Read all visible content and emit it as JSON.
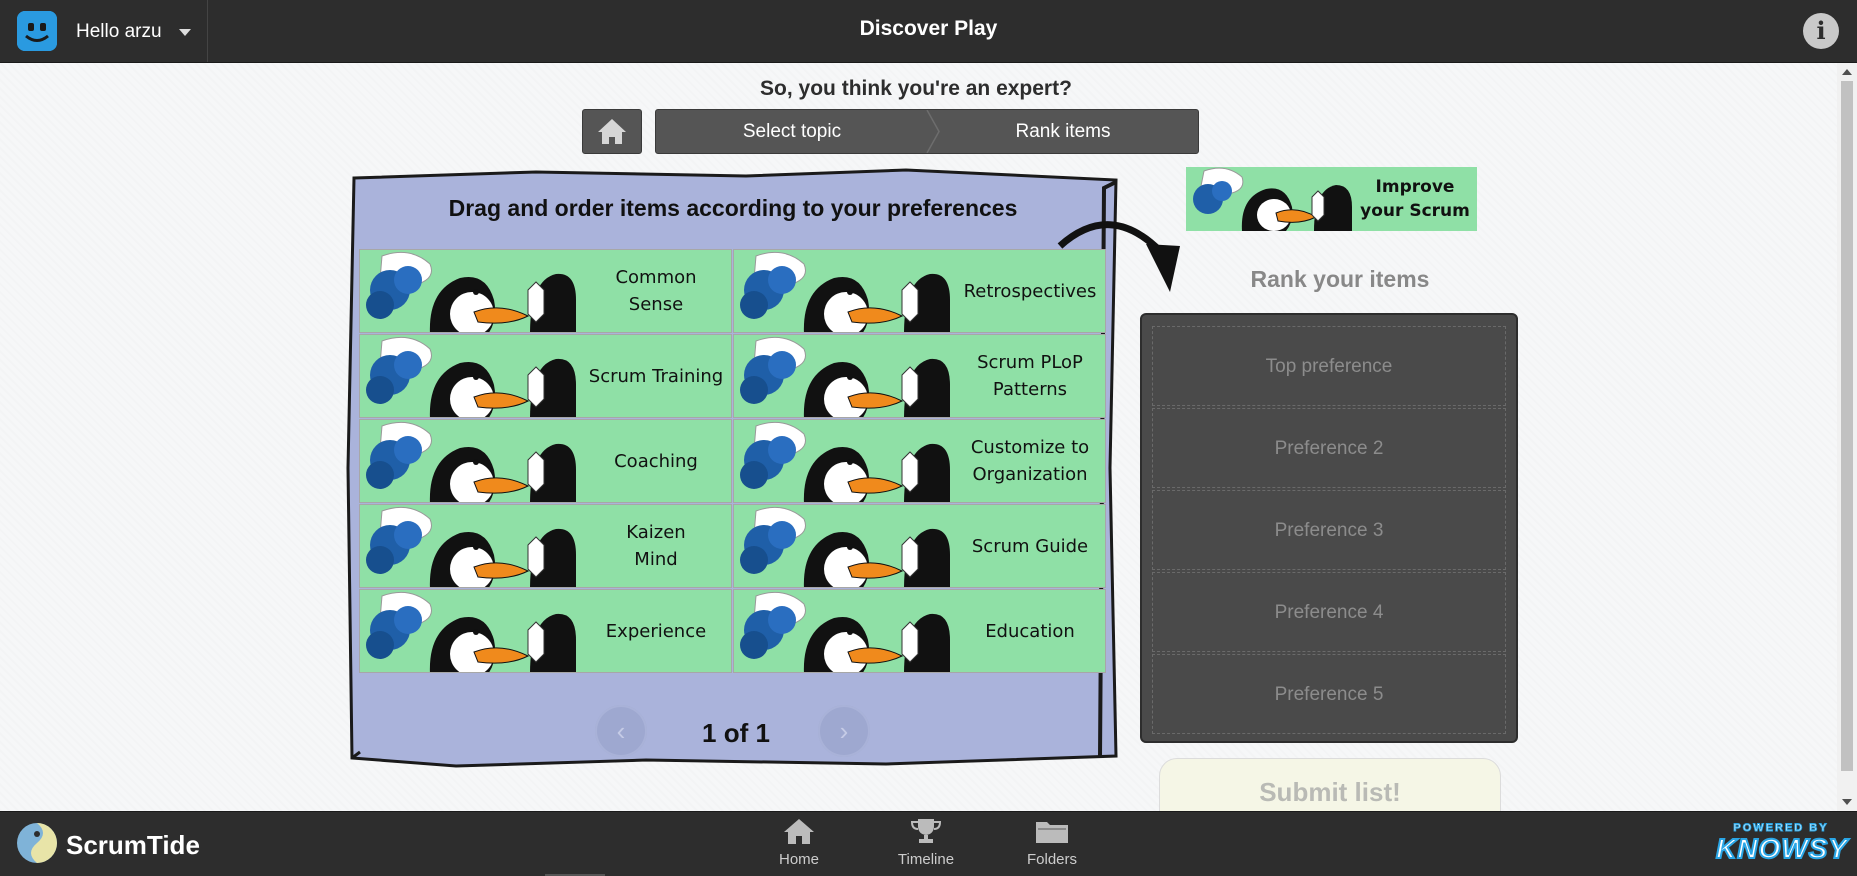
{
  "header": {
    "greeting": "Hello arzu",
    "app_title": "Discover Play"
  },
  "main": {
    "headline": "So, you think you're an expert?",
    "steps": [
      "Select topic",
      "Rank items"
    ],
    "board_title": "Drag and order items according to your preferences",
    "items": [
      "Common\nSense",
      "Retrospectives",
      "Scrum Training",
      "Scrum PLoP\nPatterns",
      "Coaching",
      "Customize to\nOrganization",
      "Kaizen\nMind",
      "Scrum Guide",
      "Experience",
      "Education"
    ],
    "pager": {
      "label": "1 of 1",
      "prev": "‹",
      "next": "›"
    }
  },
  "panel": {
    "banner_text": "Improve\nyour Scrum",
    "rank_title": "Rank your items",
    "slots": [
      "Top preference",
      "Preference 2",
      "Preference 3",
      "Preference 4",
      "Preference 5"
    ],
    "submit_label": "Submit list!"
  },
  "footer": {
    "brand": "ScrumTide",
    "nav": [
      "Home",
      "Timeline",
      "Folders"
    ],
    "powered_by": "POWERED BY",
    "powered_brand": "KNOWSY"
  },
  "colors": {
    "bar": "#2d2d2d",
    "board": "#aab3db",
    "tile": "#8fe0a6",
    "panel": "#4a4a4a"
  }
}
